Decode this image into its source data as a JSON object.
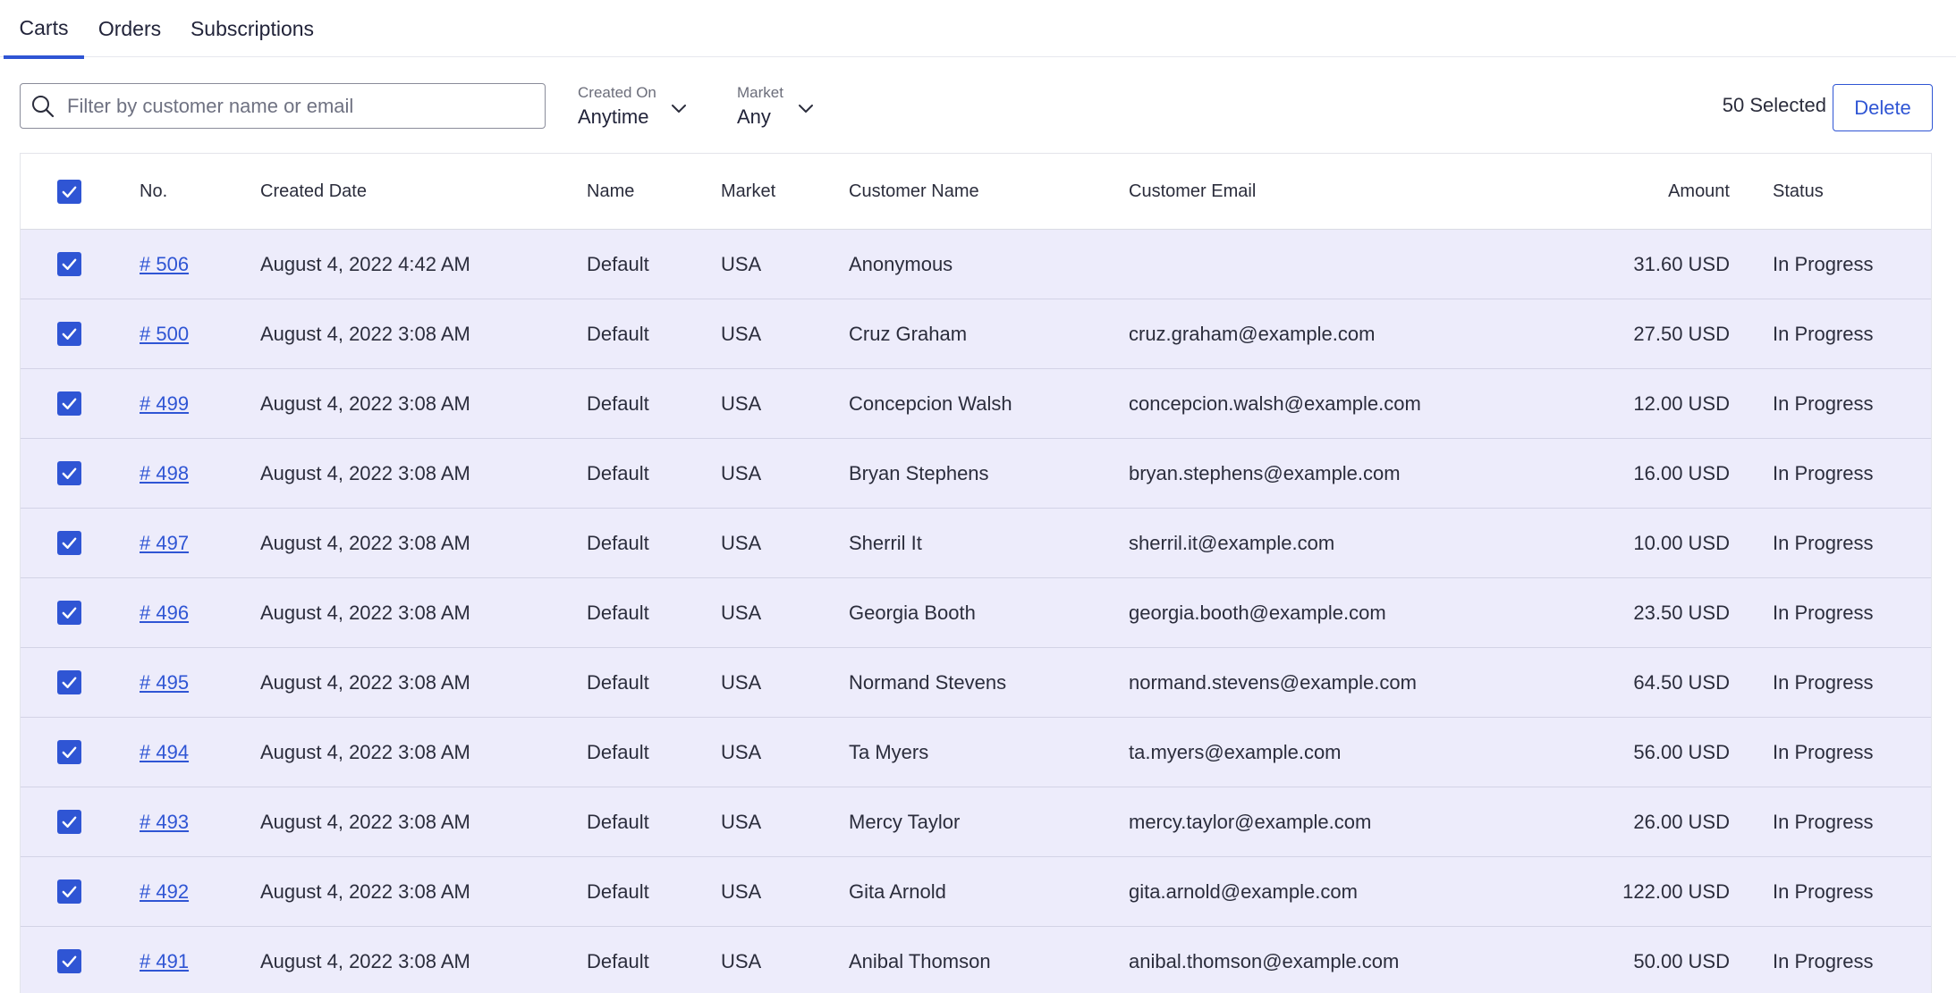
{
  "tabs": [
    {
      "label": "Carts",
      "active": true
    },
    {
      "label": "Orders",
      "active": false
    },
    {
      "label": "Subscriptions",
      "active": false
    }
  ],
  "search": {
    "placeholder": "Filter by customer name or email",
    "icon": "search-icon"
  },
  "filters": {
    "created_on": {
      "label": "Created On",
      "value": "Anytime"
    },
    "market": {
      "label": "Market",
      "value": "Any"
    }
  },
  "toolbar": {
    "selected_count": "50 Selected",
    "delete_label": "Delete"
  },
  "colors": {
    "accent": "#2f55d4",
    "row_selected_bg": "#edecfb"
  },
  "table": {
    "all_selected": true,
    "columns": {
      "no": "No.",
      "created": "Created Date",
      "name": "Name",
      "market": "Market",
      "customer": "Customer Name",
      "email": "Customer Email",
      "amount": "Amount",
      "status": "Status"
    },
    "rows": [
      {
        "no": "# 506",
        "created": "August 4, 2022 4:42 AM",
        "name": "Default",
        "market": "USA",
        "customer": "Anonymous",
        "email": "",
        "amount": "31.60 USD",
        "status": "In Progress",
        "selected": true
      },
      {
        "no": "# 500",
        "created": "August 4, 2022 3:08 AM",
        "name": "Default",
        "market": "USA",
        "customer": "Cruz Graham",
        "email": "cruz.graham@example.com",
        "amount": "27.50 USD",
        "status": "In Progress",
        "selected": true
      },
      {
        "no": "# 499",
        "created": "August 4, 2022 3:08 AM",
        "name": "Default",
        "market": "USA",
        "customer": "Concepcion Walsh",
        "email": "concepcion.walsh@example.com",
        "amount": "12.00 USD",
        "status": "In Progress",
        "selected": true
      },
      {
        "no": "# 498",
        "created": "August 4, 2022 3:08 AM",
        "name": "Default",
        "market": "USA",
        "customer": "Bryan Stephens",
        "email": "bryan.stephens@example.com",
        "amount": "16.00 USD",
        "status": "In Progress",
        "selected": true
      },
      {
        "no": "# 497",
        "created": "August 4, 2022 3:08 AM",
        "name": "Default",
        "market": "USA",
        "customer": "Sherril It",
        "email": "sherril.it@example.com",
        "amount": "10.00 USD",
        "status": "In Progress",
        "selected": true
      },
      {
        "no": "# 496",
        "created": "August 4, 2022 3:08 AM",
        "name": "Default",
        "market": "USA",
        "customer": "Georgia Booth",
        "email": "georgia.booth@example.com",
        "amount": "23.50 USD",
        "status": "In Progress",
        "selected": true
      },
      {
        "no": "# 495",
        "created": "August 4, 2022 3:08 AM",
        "name": "Default",
        "market": "USA",
        "customer": "Normand Stevens",
        "email": "normand.stevens@example.com",
        "amount": "64.50 USD",
        "status": "In Progress",
        "selected": true
      },
      {
        "no": "# 494",
        "created": "August 4, 2022 3:08 AM",
        "name": "Default",
        "market": "USA",
        "customer": "Ta Myers",
        "email": "ta.myers@example.com",
        "amount": "56.00 USD",
        "status": "In Progress",
        "selected": true
      },
      {
        "no": "# 493",
        "created": "August 4, 2022 3:08 AM",
        "name": "Default",
        "market": "USA",
        "customer": "Mercy Taylor",
        "email": "mercy.taylor@example.com",
        "amount": "26.00 USD",
        "status": "In Progress",
        "selected": true
      },
      {
        "no": "# 492",
        "created": "August 4, 2022 3:08 AM",
        "name": "Default",
        "market": "USA",
        "customer": "Gita Arnold",
        "email": "gita.arnold@example.com",
        "amount": "122.00 USD",
        "status": "In Progress",
        "selected": true
      },
      {
        "no": "# 491",
        "created": "August 4, 2022 3:08 AM",
        "name": "Default",
        "market": "USA",
        "customer": "Anibal Thomson",
        "email": "anibal.thomson@example.com",
        "amount": "50.00 USD",
        "status": "In Progress",
        "selected": true
      }
    ]
  }
}
